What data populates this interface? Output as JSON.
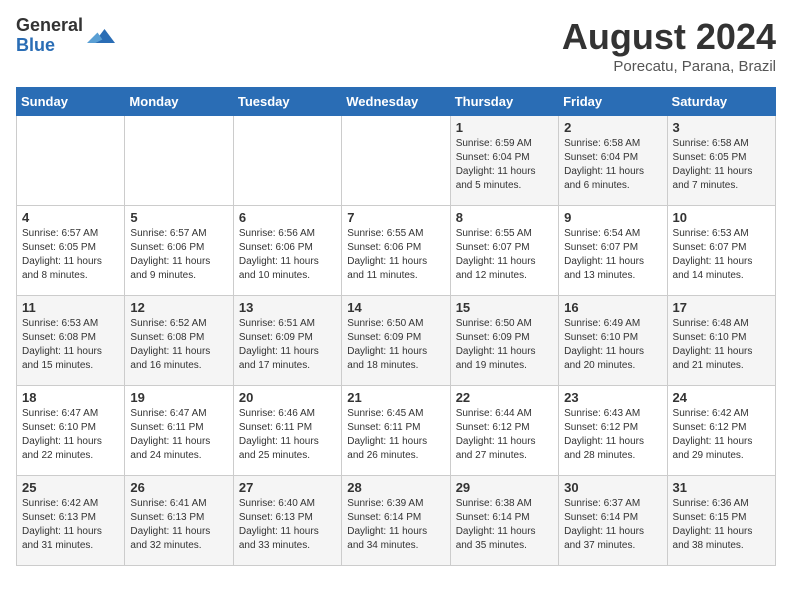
{
  "logo": {
    "general": "General",
    "blue": "Blue"
  },
  "title": "August 2024",
  "location": "Porecatu, Parana, Brazil",
  "days_of_week": [
    "Sunday",
    "Monday",
    "Tuesday",
    "Wednesday",
    "Thursday",
    "Friday",
    "Saturday"
  ],
  "weeks": [
    [
      {
        "day": "",
        "info": ""
      },
      {
        "day": "",
        "info": ""
      },
      {
        "day": "",
        "info": ""
      },
      {
        "day": "",
        "info": ""
      },
      {
        "day": "1",
        "info": "Sunrise: 6:59 AM\nSunset: 6:04 PM\nDaylight: 11 hours\nand 5 minutes."
      },
      {
        "day": "2",
        "info": "Sunrise: 6:58 AM\nSunset: 6:04 PM\nDaylight: 11 hours\nand 6 minutes."
      },
      {
        "day": "3",
        "info": "Sunrise: 6:58 AM\nSunset: 6:05 PM\nDaylight: 11 hours\nand 7 minutes."
      }
    ],
    [
      {
        "day": "4",
        "info": "Sunrise: 6:57 AM\nSunset: 6:05 PM\nDaylight: 11 hours\nand 8 minutes."
      },
      {
        "day": "5",
        "info": "Sunrise: 6:57 AM\nSunset: 6:06 PM\nDaylight: 11 hours\nand 9 minutes."
      },
      {
        "day": "6",
        "info": "Sunrise: 6:56 AM\nSunset: 6:06 PM\nDaylight: 11 hours\nand 10 minutes."
      },
      {
        "day": "7",
        "info": "Sunrise: 6:55 AM\nSunset: 6:06 PM\nDaylight: 11 hours\nand 11 minutes."
      },
      {
        "day": "8",
        "info": "Sunrise: 6:55 AM\nSunset: 6:07 PM\nDaylight: 11 hours\nand 12 minutes."
      },
      {
        "day": "9",
        "info": "Sunrise: 6:54 AM\nSunset: 6:07 PM\nDaylight: 11 hours\nand 13 minutes."
      },
      {
        "day": "10",
        "info": "Sunrise: 6:53 AM\nSunset: 6:07 PM\nDaylight: 11 hours\nand 14 minutes."
      }
    ],
    [
      {
        "day": "11",
        "info": "Sunrise: 6:53 AM\nSunset: 6:08 PM\nDaylight: 11 hours\nand 15 minutes."
      },
      {
        "day": "12",
        "info": "Sunrise: 6:52 AM\nSunset: 6:08 PM\nDaylight: 11 hours\nand 16 minutes."
      },
      {
        "day": "13",
        "info": "Sunrise: 6:51 AM\nSunset: 6:09 PM\nDaylight: 11 hours\nand 17 minutes."
      },
      {
        "day": "14",
        "info": "Sunrise: 6:50 AM\nSunset: 6:09 PM\nDaylight: 11 hours\nand 18 minutes."
      },
      {
        "day": "15",
        "info": "Sunrise: 6:50 AM\nSunset: 6:09 PM\nDaylight: 11 hours\nand 19 minutes."
      },
      {
        "day": "16",
        "info": "Sunrise: 6:49 AM\nSunset: 6:10 PM\nDaylight: 11 hours\nand 20 minutes."
      },
      {
        "day": "17",
        "info": "Sunrise: 6:48 AM\nSunset: 6:10 PM\nDaylight: 11 hours\nand 21 minutes."
      }
    ],
    [
      {
        "day": "18",
        "info": "Sunrise: 6:47 AM\nSunset: 6:10 PM\nDaylight: 11 hours\nand 22 minutes."
      },
      {
        "day": "19",
        "info": "Sunrise: 6:47 AM\nSunset: 6:11 PM\nDaylight: 11 hours\nand 24 minutes."
      },
      {
        "day": "20",
        "info": "Sunrise: 6:46 AM\nSunset: 6:11 PM\nDaylight: 11 hours\nand 25 minutes."
      },
      {
        "day": "21",
        "info": "Sunrise: 6:45 AM\nSunset: 6:11 PM\nDaylight: 11 hours\nand 26 minutes."
      },
      {
        "day": "22",
        "info": "Sunrise: 6:44 AM\nSunset: 6:12 PM\nDaylight: 11 hours\nand 27 minutes."
      },
      {
        "day": "23",
        "info": "Sunrise: 6:43 AM\nSunset: 6:12 PM\nDaylight: 11 hours\nand 28 minutes."
      },
      {
        "day": "24",
        "info": "Sunrise: 6:42 AM\nSunset: 6:12 PM\nDaylight: 11 hours\nand 29 minutes."
      }
    ],
    [
      {
        "day": "25",
        "info": "Sunrise: 6:42 AM\nSunset: 6:13 PM\nDaylight: 11 hours\nand 31 minutes."
      },
      {
        "day": "26",
        "info": "Sunrise: 6:41 AM\nSunset: 6:13 PM\nDaylight: 11 hours\nand 32 minutes."
      },
      {
        "day": "27",
        "info": "Sunrise: 6:40 AM\nSunset: 6:13 PM\nDaylight: 11 hours\nand 33 minutes."
      },
      {
        "day": "28",
        "info": "Sunrise: 6:39 AM\nSunset: 6:14 PM\nDaylight: 11 hours\nand 34 minutes."
      },
      {
        "day": "29",
        "info": "Sunrise: 6:38 AM\nSunset: 6:14 PM\nDaylight: 11 hours\nand 35 minutes."
      },
      {
        "day": "30",
        "info": "Sunrise: 6:37 AM\nSunset: 6:14 PM\nDaylight: 11 hours\nand 37 minutes."
      },
      {
        "day": "31",
        "info": "Sunrise: 6:36 AM\nSunset: 6:15 PM\nDaylight: 11 hours\nand 38 minutes."
      }
    ]
  ]
}
